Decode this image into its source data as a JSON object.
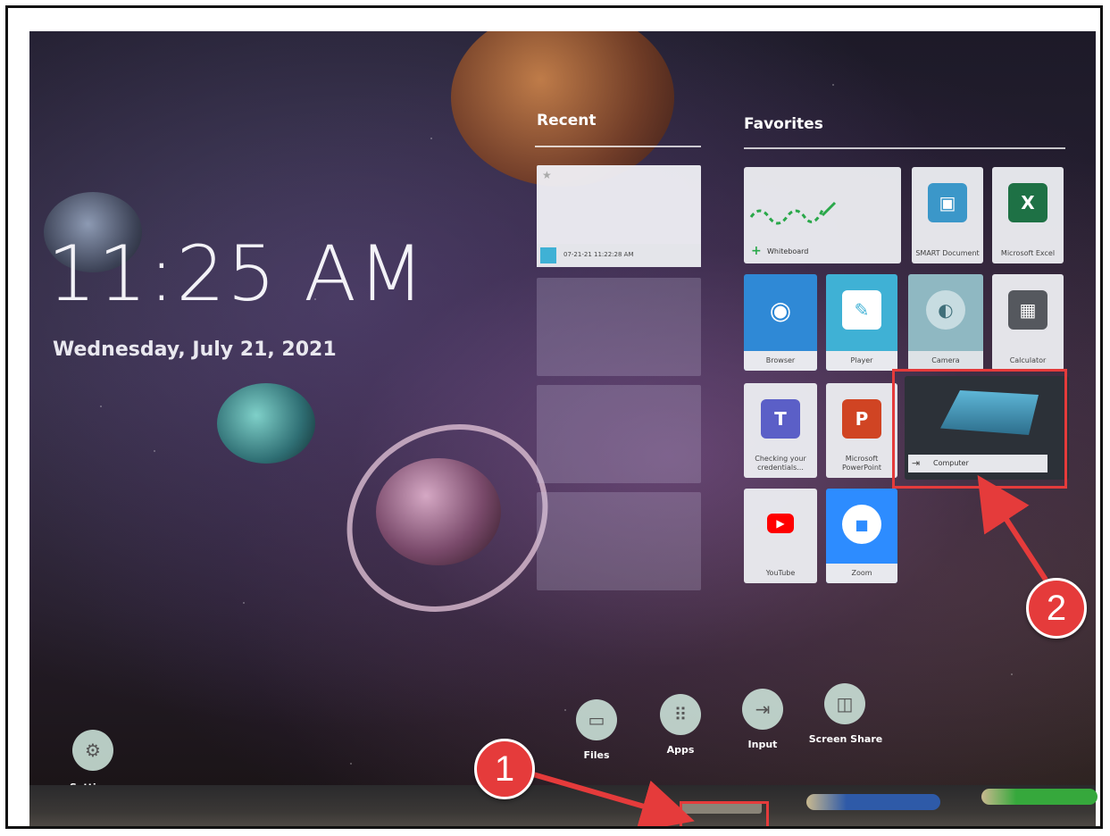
{
  "clock": {
    "time": "11:25 AM",
    "date": "Wednesday, July 21, 2021"
  },
  "sections": {
    "recent": "Recent",
    "favorites": "Favorites"
  },
  "recent": {
    "item_label": "07-21-21 11:22:28 AM"
  },
  "favorites": {
    "whiteboard": "Whiteboard",
    "smart_document": "SMART Document",
    "excel": "Microsoft Excel",
    "browser": "Browser",
    "player": "Player",
    "camera": "Camera",
    "calculator": "Calculator",
    "teams": "Checking your credentials...",
    "powerpoint": "Microsoft PowerPoint",
    "computer": "Computer",
    "youtube": "YouTube",
    "zoom": "Zoom"
  },
  "dock": {
    "files": "Files",
    "apps": "Apps",
    "input": "Input",
    "screen_share": "Screen Share"
  },
  "settings": {
    "label": "Settings"
  },
  "callouts": {
    "one": "1",
    "two": "2"
  },
  "colors": {
    "callout_red": "#e53b3b",
    "browser_blue": "#2f89d6",
    "teams_purple": "#5b5fc7",
    "ppt_red": "#d04423",
    "excel_green": "#1e7145",
    "youtube_red": "#ff0000"
  }
}
